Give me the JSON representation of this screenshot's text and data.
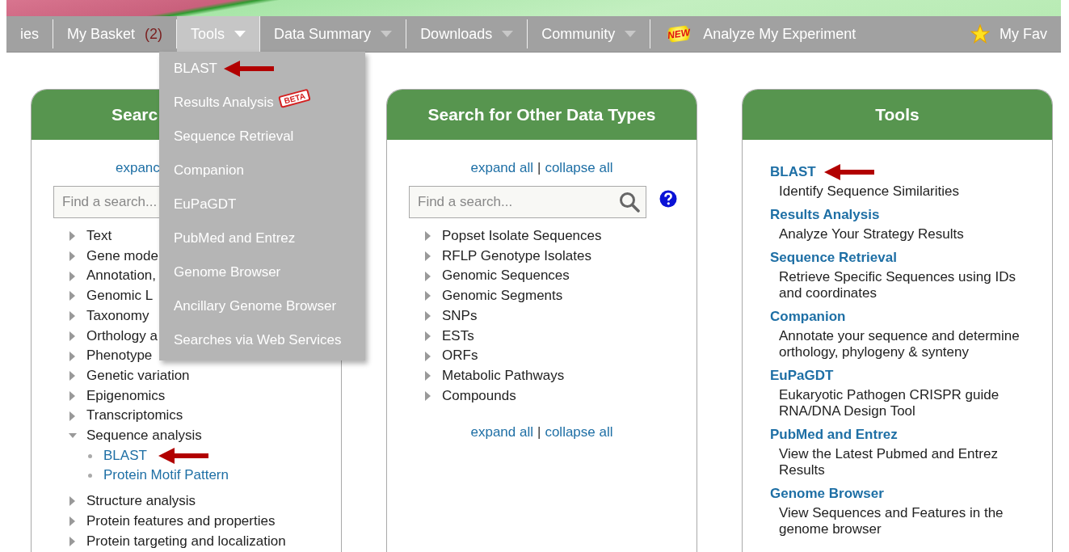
{
  "nav": {
    "items": [
      {
        "label": "ies",
        "kind": "plain",
        "selected": false
      },
      {
        "label": "My Basket",
        "count": "(2)",
        "kind": "plain",
        "selected": false
      },
      {
        "label": "Tools",
        "kind": "menu",
        "selected": true
      },
      {
        "label": "Data Summary",
        "kind": "menu",
        "selected": false
      },
      {
        "label": "Downloads",
        "kind": "menu",
        "selected": false
      },
      {
        "label": "Community",
        "kind": "menu",
        "selected": false
      },
      {
        "label": "Analyze My Experiment",
        "badge": "NEW",
        "kind": "new",
        "selected": false
      },
      {
        "label": "My Fav",
        "kind": "favorites",
        "selected": false
      }
    ]
  },
  "tools_menu": {
    "items": [
      {
        "label": "BLAST",
        "arrow": true
      },
      {
        "label": "Results Analysis",
        "badge": "BETA",
        "arrow": false
      },
      {
        "label": "Sequence Retrieval",
        "arrow": false
      },
      {
        "label": "Companion",
        "arrow": false
      },
      {
        "label": "EuPaGDT",
        "arrow": false
      },
      {
        "label": "PubMed and Entrez",
        "arrow": false
      },
      {
        "label": "Genome Browser",
        "arrow": false
      },
      {
        "label": "Ancillary Genome Browser",
        "arrow": false
      },
      {
        "label": "Searches via Web Services",
        "arrow": false
      }
    ]
  },
  "gene_search_panel": {
    "title": "Searc",
    "expand": "expanc",
    "search": {
      "placeholder": "Find a search..."
    },
    "categories": [
      {
        "label": "Text",
        "expanded": false
      },
      {
        "label": "Gene mode",
        "expanded": false
      },
      {
        "label": "Annotation,",
        "expanded": false
      },
      {
        "label": "Genomic L",
        "expanded": false
      },
      {
        "label": "Taxonomy",
        "expanded": false
      },
      {
        "label": "Orthology a",
        "expanded": false
      },
      {
        "label": "Phenotype",
        "expanded": false
      },
      {
        "label": "Genetic variation",
        "expanded": false
      },
      {
        "label": "Epigenomics",
        "expanded": false
      },
      {
        "label": "Transcriptomics",
        "expanded": false
      },
      {
        "label": "Sequence analysis",
        "expanded": true,
        "children": [
          {
            "label": "BLAST",
            "arrow": true
          },
          {
            "label": "Protein Motif Pattern",
            "arrow": false
          }
        ]
      },
      {
        "label": "Structure analysis",
        "expanded": false
      },
      {
        "label": "Protein features and properties",
        "expanded": false
      },
      {
        "label": "Protein targeting and localization",
        "expanded": false
      }
    ]
  },
  "other_data_panel": {
    "title": "Search for Other Data Types",
    "expand": "expand all",
    "separator": "|",
    "collapse": "collapse all",
    "search": {
      "placeholder": "Find a search..."
    },
    "categories": [
      {
        "label": "Popset Isolate Sequences",
        "expanded": false
      },
      {
        "label": "RFLP Genotype Isolates",
        "expanded": false
      },
      {
        "label": "Genomic Sequences",
        "expanded": false
      },
      {
        "label": "Genomic Segments",
        "expanded": false
      },
      {
        "label": "SNPs",
        "expanded": false
      },
      {
        "label": "ESTs",
        "expanded": false
      },
      {
        "label": "ORFs",
        "expanded": false
      },
      {
        "label": "Metabolic Pathways",
        "expanded": false
      },
      {
        "label": "Compounds",
        "expanded": false
      }
    ],
    "bottom_expand": "expand all",
    "bottom_separator": "|",
    "bottom_collapse": "collapse all"
  },
  "tools_panel": {
    "title": "Tools",
    "tools": [
      {
        "name": "BLAST",
        "description": "Identify Sequence Similarities",
        "arrow": true
      },
      {
        "name": "Results Analysis",
        "description": "Analyze Your Strategy Results",
        "arrow": false
      },
      {
        "name": "Sequence Retrieval",
        "description": "Retrieve Specific Sequences using IDs and coordinates",
        "arrow": false
      },
      {
        "name": "Companion",
        "description": "Annotate your sequence and determine orthology, phylogeny & synteny",
        "arrow": false
      },
      {
        "name": "EuPaGDT",
        "description": "Eukaryotic Pathogen CRISPR guide RNA/DNA Design Tool",
        "arrow": false
      },
      {
        "name": "PubMed and Entrez",
        "description": "View the Latest Pubmed and Entrez Results",
        "arrow": false
      },
      {
        "name": "Genome Browser",
        "description": "View Sequences and Features in the genome browser",
        "arrow": false
      }
    ]
  }
}
